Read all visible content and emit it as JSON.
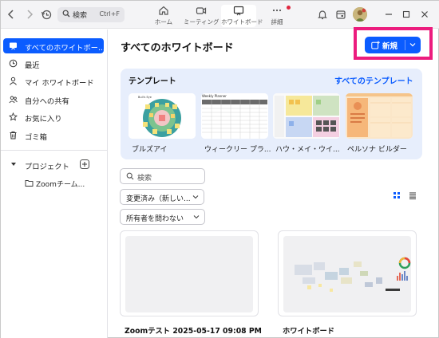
{
  "titlebar": {
    "search_label": "検索",
    "search_shortcut": "Ctrl+F",
    "tabs": [
      {
        "label": "ホーム",
        "icon": "home-icon"
      },
      {
        "label": "ミーティング",
        "icon": "video-icon"
      },
      {
        "label": "ホワイトボード",
        "icon": "whiteboard-icon",
        "active": true
      },
      {
        "label": "詳細",
        "icon": "more-icon",
        "notification": true
      }
    ]
  },
  "sidebar": {
    "items": [
      {
        "label": "すべてのホワイトボー...",
        "icon": "whiteboard-icon",
        "active": true
      },
      {
        "label": "最近",
        "icon": "clock-icon"
      },
      {
        "label": "マイ ホワイトボード",
        "icon": "person-icon"
      },
      {
        "label": "自分への共有",
        "icon": "shared-users-icon"
      },
      {
        "label": "お気に入り",
        "icon": "star-icon"
      },
      {
        "label": "ゴミ箱",
        "icon": "trash-icon"
      }
    ],
    "projects_label": "プロジェクト",
    "project_items": [
      {
        "label": "Zoomチーム...",
        "icon": "folder-icon"
      }
    ]
  },
  "main": {
    "title": "すべてのホワイトボード",
    "new_button_label": "新規"
  },
  "templates": {
    "heading": "テンプレート",
    "see_all": "すべてのテンプレート",
    "items": [
      {
        "caption": "ブルズアイ",
        "thumb_title": "Bull's Eye"
      },
      {
        "caption": "ウィークリー プラ...",
        "thumb_title": "Weekly Planner"
      },
      {
        "caption": "ハウ・メイ・ウイ...",
        "thumb_title": ""
      },
      {
        "caption": "ペルソナ ビルダー",
        "thumb_title": ""
      }
    ]
  },
  "filters": {
    "search_placeholder": "検索",
    "sort_value": "変更済み（新しい...",
    "owner_value": "所有者を問わない"
  },
  "boards": [
    {
      "title": "Zoomテスト 2025-05-17 09:08 PM"
    },
    {
      "title": "ホワイトボード"
    }
  ],
  "colors": {
    "accent": "#0b5cff",
    "highlight": "#ec1c7e",
    "template_panel": "#e7eefc"
  }
}
